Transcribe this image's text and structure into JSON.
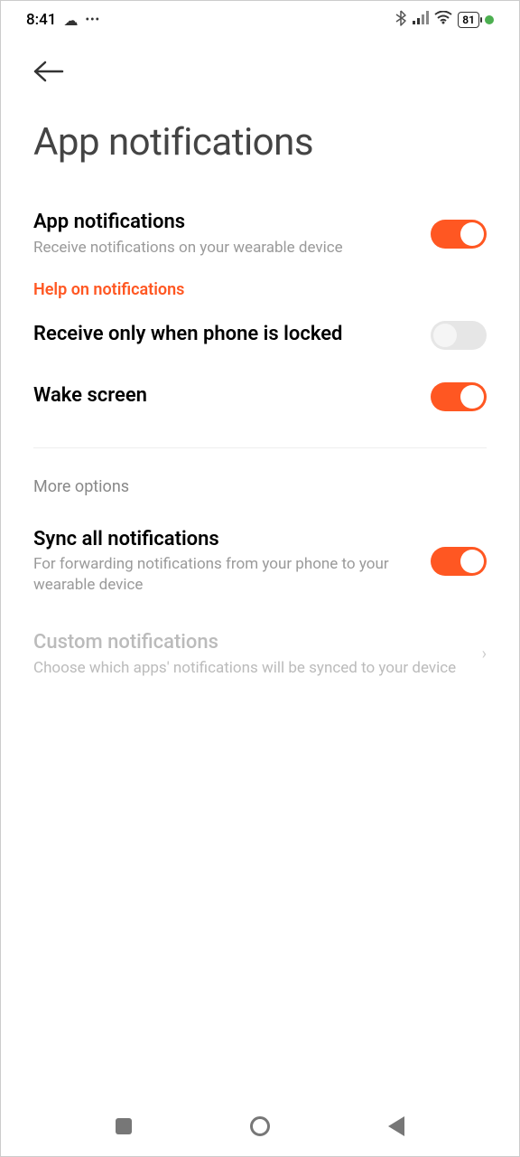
{
  "status": {
    "time": "8:41",
    "battery": "81"
  },
  "page": {
    "title": "App notifications"
  },
  "settings": {
    "app_notifications": {
      "title": "App notifications",
      "subtitle": "Receive notifications on your wearable device",
      "on": true
    },
    "help_link": "Help on notifications",
    "receive_locked": {
      "title": "Receive only when phone is locked",
      "on": false
    },
    "wake_screen": {
      "title": "Wake screen",
      "on": true
    },
    "more_options_header": "More options",
    "sync_all": {
      "title": "Sync all notifications",
      "subtitle": "For forwarding notifications from your phone to your wearable device",
      "on": true
    },
    "custom": {
      "title": "Custom notifications",
      "subtitle": "Choose which apps' notifications will be synced to your device"
    }
  }
}
